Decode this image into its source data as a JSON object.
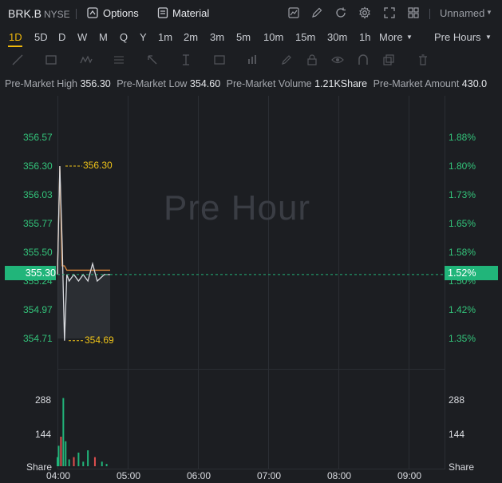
{
  "header": {
    "symbol": "BRK.B",
    "exchange": "NYSE",
    "options_label": "Options",
    "material_label": "Material",
    "layout_label": "Unnamed"
  },
  "timeframes": [
    "1D",
    "5D",
    "D",
    "W",
    "M",
    "Q",
    "Y",
    "1m",
    "2m",
    "3m",
    "5m",
    "10m",
    "15m",
    "30m",
    "1h"
  ],
  "more_label": "More",
  "session_label": "Pre Hours",
  "stats": {
    "high_label": "Pre-Market High",
    "high": "356.30",
    "low_label": "Pre-Market Low",
    "low": "354.60",
    "volume_label": "Pre-Market Volume",
    "volume": "1.21KShare",
    "amount_label": "Pre-Market Amount",
    "amount": "430.0"
  },
  "watermark": "Pre Hour",
  "price_axis": [
    "356.57",
    "356.30",
    "356.03",
    "355.77",
    "355.50",
    "355.24",
    "354.97",
    "354.71"
  ],
  "pct_axis": [
    "1.88%",
    "1.80%",
    "1.73%",
    "1.65%",
    "1.58%",
    "1.50%",
    "1.42%",
    "1.35%"
  ],
  "last_price": "355.30",
  "last_pct": "1.52%",
  "high_marker": "356.30",
  "low_marker": "354.69",
  "volume_axis": [
    "288",
    "144"
  ],
  "volume_unit": "Share",
  "time_axis": [
    "04:00",
    "05:00",
    "06:00",
    "07:00",
    "08:00",
    "09:00"
  ],
  "colors": {
    "accent": "#f0b90b",
    "up": "#21b57a",
    "down": "#e04f4f",
    "avg": "#e0883a"
  },
  "chart_data": {
    "type": "line",
    "series": [
      {
        "x": [
          "04:00",
          "04:02",
          "04:04",
          "04:06",
          "04:08",
          "04:10",
          "04:14",
          "04:18",
          "04:22",
          "04:26",
          "04:30",
          "04:34",
          "04:40",
          "04:45"
        ],
        "values": [
          355.3,
          356.3,
          355.6,
          354.69,
          355.3,
          355.24,
          355.3,
          355.24,
          355.3,
          355.24,
          355.4,
          355.24,
          355.3,
          355.3
        ]
      }
    ],
    "volume": {
      "x": [
        "04:00",
        "04:01",
        "04:03",
        "04:05",
        "04:07",
        "04:10",
        "04:14",
        "04:18",
        "04:22",
        "04:26",
        "04:32",
        "04:38",
        "04:42"
      ],
      "values": [
        40,
        90,
        130,
        300,
        110,
        30,
        40,
        60,
        20,
        70,
        40,
        20,
        10
      ]
    },
    "ylim": [
      354.71,
      356.57
    ]
  }
}
